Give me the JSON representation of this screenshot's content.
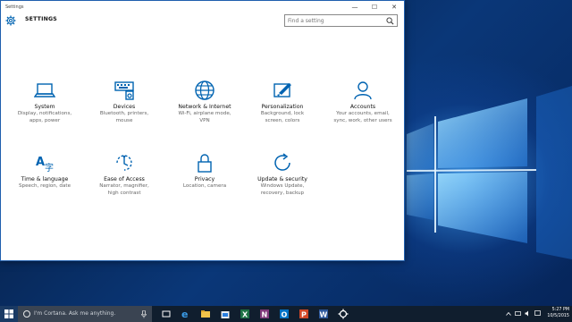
{
  "window": {
    "title": "Settings",
    "controls": [
      "—",
      "☐",
      "✕"
    ]
  },
  "header": {
    "title": "SETTINGS",
    "search_placeholder": "Find a setting"
  },
  "tiles": [
    {
      "name": "System",
      "desc1": "Display, notifications,",
      "desc2": "apps, power",
      "icon": "laptop-icon"
    },
    {
      "name": "Devices",
      "desc1": "Bluetooth, printers,",
      "desc2": "mouse",
      "icon": "devices-icon"
    },
    {
      "name": "Network & Internet",
      "desc1": "Wi-Fi, airplane mode,",
      "desc2": "VPN",
      "icon": "globe-icon"
    },
    {
      "name": "Personalization",
      "desc1": "Background, lock",
      "desc2": "screen, colors",
      "icon": "paint-icon"
    },
    {
      "name": "Accounts",
      "desc1": "Your accounts, email,",
      "desc2": "sync, work, other users",
      "icon": "person-icon"
    },
    {
      "name": "Time & language",
      "desc1": "Speech, region, date",
      "desc2": "",
      "icon": "language-icon"
    },
    {
      "name": "Ease of Access",
      "desc1": "Narrator, magnifier,",
      "desc2": "high contrast",
      "icon": "ease-of-access-icon"
    },
    {
      "name": "Privacy",
      "desc1": "Location, camera",
      "desc2": "",
      "icon": "lock-icon"
    },
    {
      "name": "Update & security",
      "desc1": "Windows Update,",
      "desc2": "recovery, backup",
      "icon": "refresh-icon"
    }
  ],
  "taskbar": {
    "cortana_placeholder": "I'm Cortana. Ask me anything.",
    "apps": [
      "task-view-icon",
      "edge-icon",
      "file-explorer-icon",
      "store-icon",
      "excel-icon",
      "onenote-icon",
      "outlook-icon",
      "powerpoint-icon",
      "word-icon",
      "settings-icon"
    ],
    "time": "5:27 PM",
    "date": "10/5/2015"
  },
  "colors": {
    "accent": "#0063b1",
    "taskbar": "#101e2e"
  }
}
